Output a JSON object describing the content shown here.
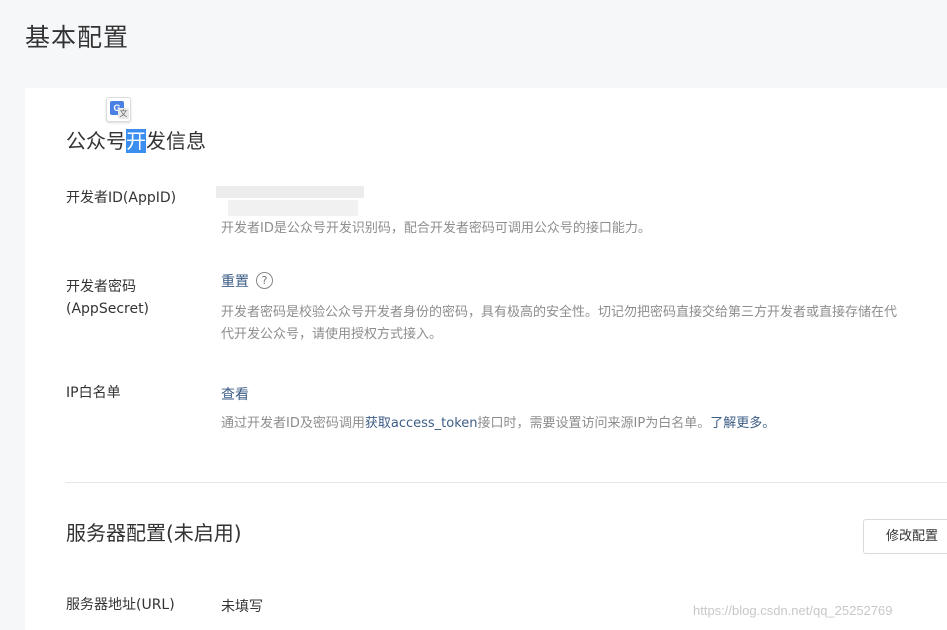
{
  "page": {
    "title": "基本配置"
  },
  "developer_info": {
    "title_before": "公众号",
    "title_highlight": "开",
    "title_after": "发信息",
    "app_id": {
      "label": "开发者ID(AppID)",
      "description": "开发者ID是公众号开发识别码，配合开发者密码可调用公众号的接口能力。"
    },
    "app_secret": {
      "label_line1": "开发者密码",
      "label_line2": "(AppSecret)",
      "reset_label": "重置",
      "help_glyph": "?",
      "description_line1": "开发者密码是校验公众号开发者身份的密码，具有极高的安全性。切记勿把密码直接交给第三方开发者或直接存储在代",
      "description_line2": "代开发公众号，请使用授权方式接入。"
    },
    "ip_whitelist": {
      "label": "IP白名单",
      "view_label": "查看",
      "description_before": "通过开发者ID及密码调用",
      "description_link1": "获取access_token",
      "description_middle": "接口时，需要设置访问来源IP为白名单。",
      "description_link2": "了解更多。"
    }
  },
  "server_config": {
    "title": "服务器配置(未启用)",
    "modify_button": "修改配置",
    "url_label": "服务器地址(URL)",
    "url_value": "未填写"
  },
  "translate_icon": {
    "glyph_g": "G",
    "glyph_t": "文"
  },
  "watermark": "https://blog.csdn.net/qq_25252769",
  "colors": {
    "highlight": "#3a8ef0",
    "link": "#3c5d86",
    "description": "#8d8d8d"
  }
}
